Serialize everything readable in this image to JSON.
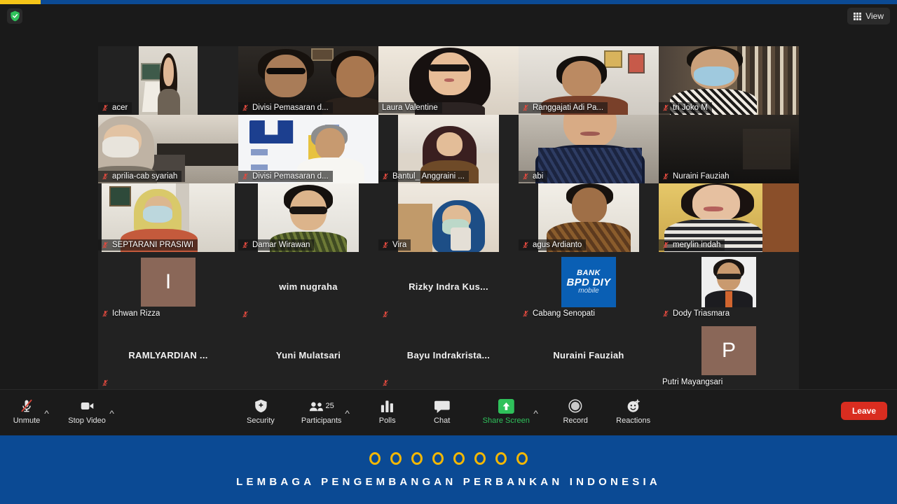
{
  "app": {
    "name": "Zoom Meeting",
    "encryption_icon": "green-shield-icon"
  },
  "topbar": {
    "view_button_label": "View",
    "view_icon": "grid-icon"
  },
  "gallery": {
    "tiles": [
      {
        "name": "acer",
        "muted": true,
        "kind": "video",
        "video_width": "narrow",
        "scene": "woman-in-office-whiteboard"
      },
      {
        "name": "Divisi Pemasaran d...",
        "muted": true,
        "kind": "video",
        "video_width": "full",
        "scene": "two-men-glasses-room"
      },
      {
        "name": "Laura Valentine",
        "muted": false,
        "kind": "video",
        "video_width": "full",
        "scene": "young-woman-glasses",
        "active_speaker": true
      },
      {
        "name": "Ranggajati Adi Pa...",
        "muted": true,
        "kind": "video",
        "video_width": "full",
        "scene": "man-batik-wall-frames"
      },
      {
        "name": "tri Joko M",
        "muted": true,
        "kind": "video",
        "video_width": "full",
        "scene": "man-mask-bookshelf"
      },
      {
        "name": "aprilia-cab syariah",
        "muted": true,
        "kind": "video",
        "video_width": "full",
        "scene": "woman-hijab-mask-office"
      },
      {
        "name": "Divisi Pemasaran d...",
        "muted": true,
        "kind": "video",
        "video_width": "full",
        "scene": "man-white-shirt-lppi-backdrop"
      },
      {
        "name": "Bantul_ Anggraini ...",
        "muted": true,
        "kind": "video",
        "video_width": "mid",
        "scene": "woman-hijab-sofa"
      },
      {
        "name": "abi",
        "muted": true,
        "kind": "video",
        "video_width": "full",
        "scene": "person-dark-batik"
      },
      {
        "name": "Nuraini Fauziah",
        "muted": true,
        "kind": "video",
        "video_width": "full",
        "scene": "dark-room"
      },
      {
        "name": "SEPTARANI PRASIWI",
        "muted": true,
        "kind": "video",
        "video_width": "wide",
        "scene": "woman-yellow-hijab-mask"
      },
      {
        "name": "Damar Wirawan",
        "muted": true,
        "kind": "video",
        "video_width": "mid",
        "scene": "man-glasses-batik"
      },
      {
        "name": "Vira",
        "muted": true,
        "kind": "video",
        "video_width": "mid",
        "scene": "woman-hijab-drinking"
      },
      {
        "name": "agus Ardianto",
        "muted": true,
        "kind": "video",
        "video_width": "mid",
        "scene": "man-batik-light-wall"
      },
      {
        "name": "merylin indah",
        "muted": true,
        "kind": "video",
        "video_width": "full",
        "scene": "woman-striped-shirt"
      },
      {
        "name": "Ichwan Rizza",
        "muted": true,
        "kind": "avatar-initial",
        "initial": "I",
        "avatar_color": "#8a6758"
      },
      {
        "name": "wim nugraha",
        "muted": true,
        "kind": "name-only"
      },
      {
        "name": "Rizky Indra Kus...",
        "muted": true,
        "kind": "name-only"
      },
      {
        "name": "Cabang Senopati",
        "muted": true,
        "kind": "avatar-logo",
        "logo": {
          "line1": "BANK",
          "line2": "BPD DIY",
          "line3": "mobile",
          "color": "#0a5fb4"
        }
      },
      {
        "name": "Dody Triasmara",
        "muted": true,
        "kind": "avatar-photo",
        "scene": "man-glasses-suit-portrait"
      },
      {
        "name": "RAMLYARDIAN ...",
        "muted": true,
        "kind": "name-only"
      },
      {
        "name": "Yuni Mulatsari",
        "muted": false,
        "kind": "name-only"
      },
      {
        "name": "Bayu  Indrakrista...",
        "muted": true,
        "kind": "name-only"
      },
      {
        "name": "Nuraini Fauziah",
        "muted": false,
        "kind": "name-only"
      },
      {
        "name": "Putri Mayangsari",
        "muted": false,
        "kind": "avatar-initial",
        "initial": "P",
        "avatar_color": "#8a6758"
      }
    ]
  },
  "controls": {
    "left": [
      {
        "label": "Unmute",
        "icon": "microphone-muted-icon",
        "has_caret": true
      },
      {
        "label": "Stop Video",
        "icon": "video-camera-icon",
        "has_caret": true
      }
    ],
    "center": [
      {
        "label": "Security",
        "icon": "shield-icon",
        "has_caret": false
      },
      {
        "label": "Participants",
        "icon": "people-icon",
        "has_caret": true,
        "badge": "25"
      },
      {
        "label": "Polls",
        "icon": "bar-chart-icon",
        "has_caret": false
      },
      {
        "label": "Chat",
        "icon": "speech-bubble-icon",
        "has_caret": false
      },
      {
        "label": "Share Screen",
        "icon": "share-screen-icon",
        "has_caret": true,
        "highlight": true
      },
      {
        "label": "Record",
        "icon": "record-circle-icon",
        "has_caret": false
      },
      {
        "label": "Reactions",
        "icon": "smiley-plus-icon",
        "has_caret": false
      }
    ],
    "leave_label": "Leave"
  },
  "banner": {
    "dot_count": 8,
    "dot_color": "#f2b705",
    "background_color": "#0b4a94",
    "text": "LEMBAGA PENGEMBANGAN PERBANKAN INDONESIA"
  }
}
